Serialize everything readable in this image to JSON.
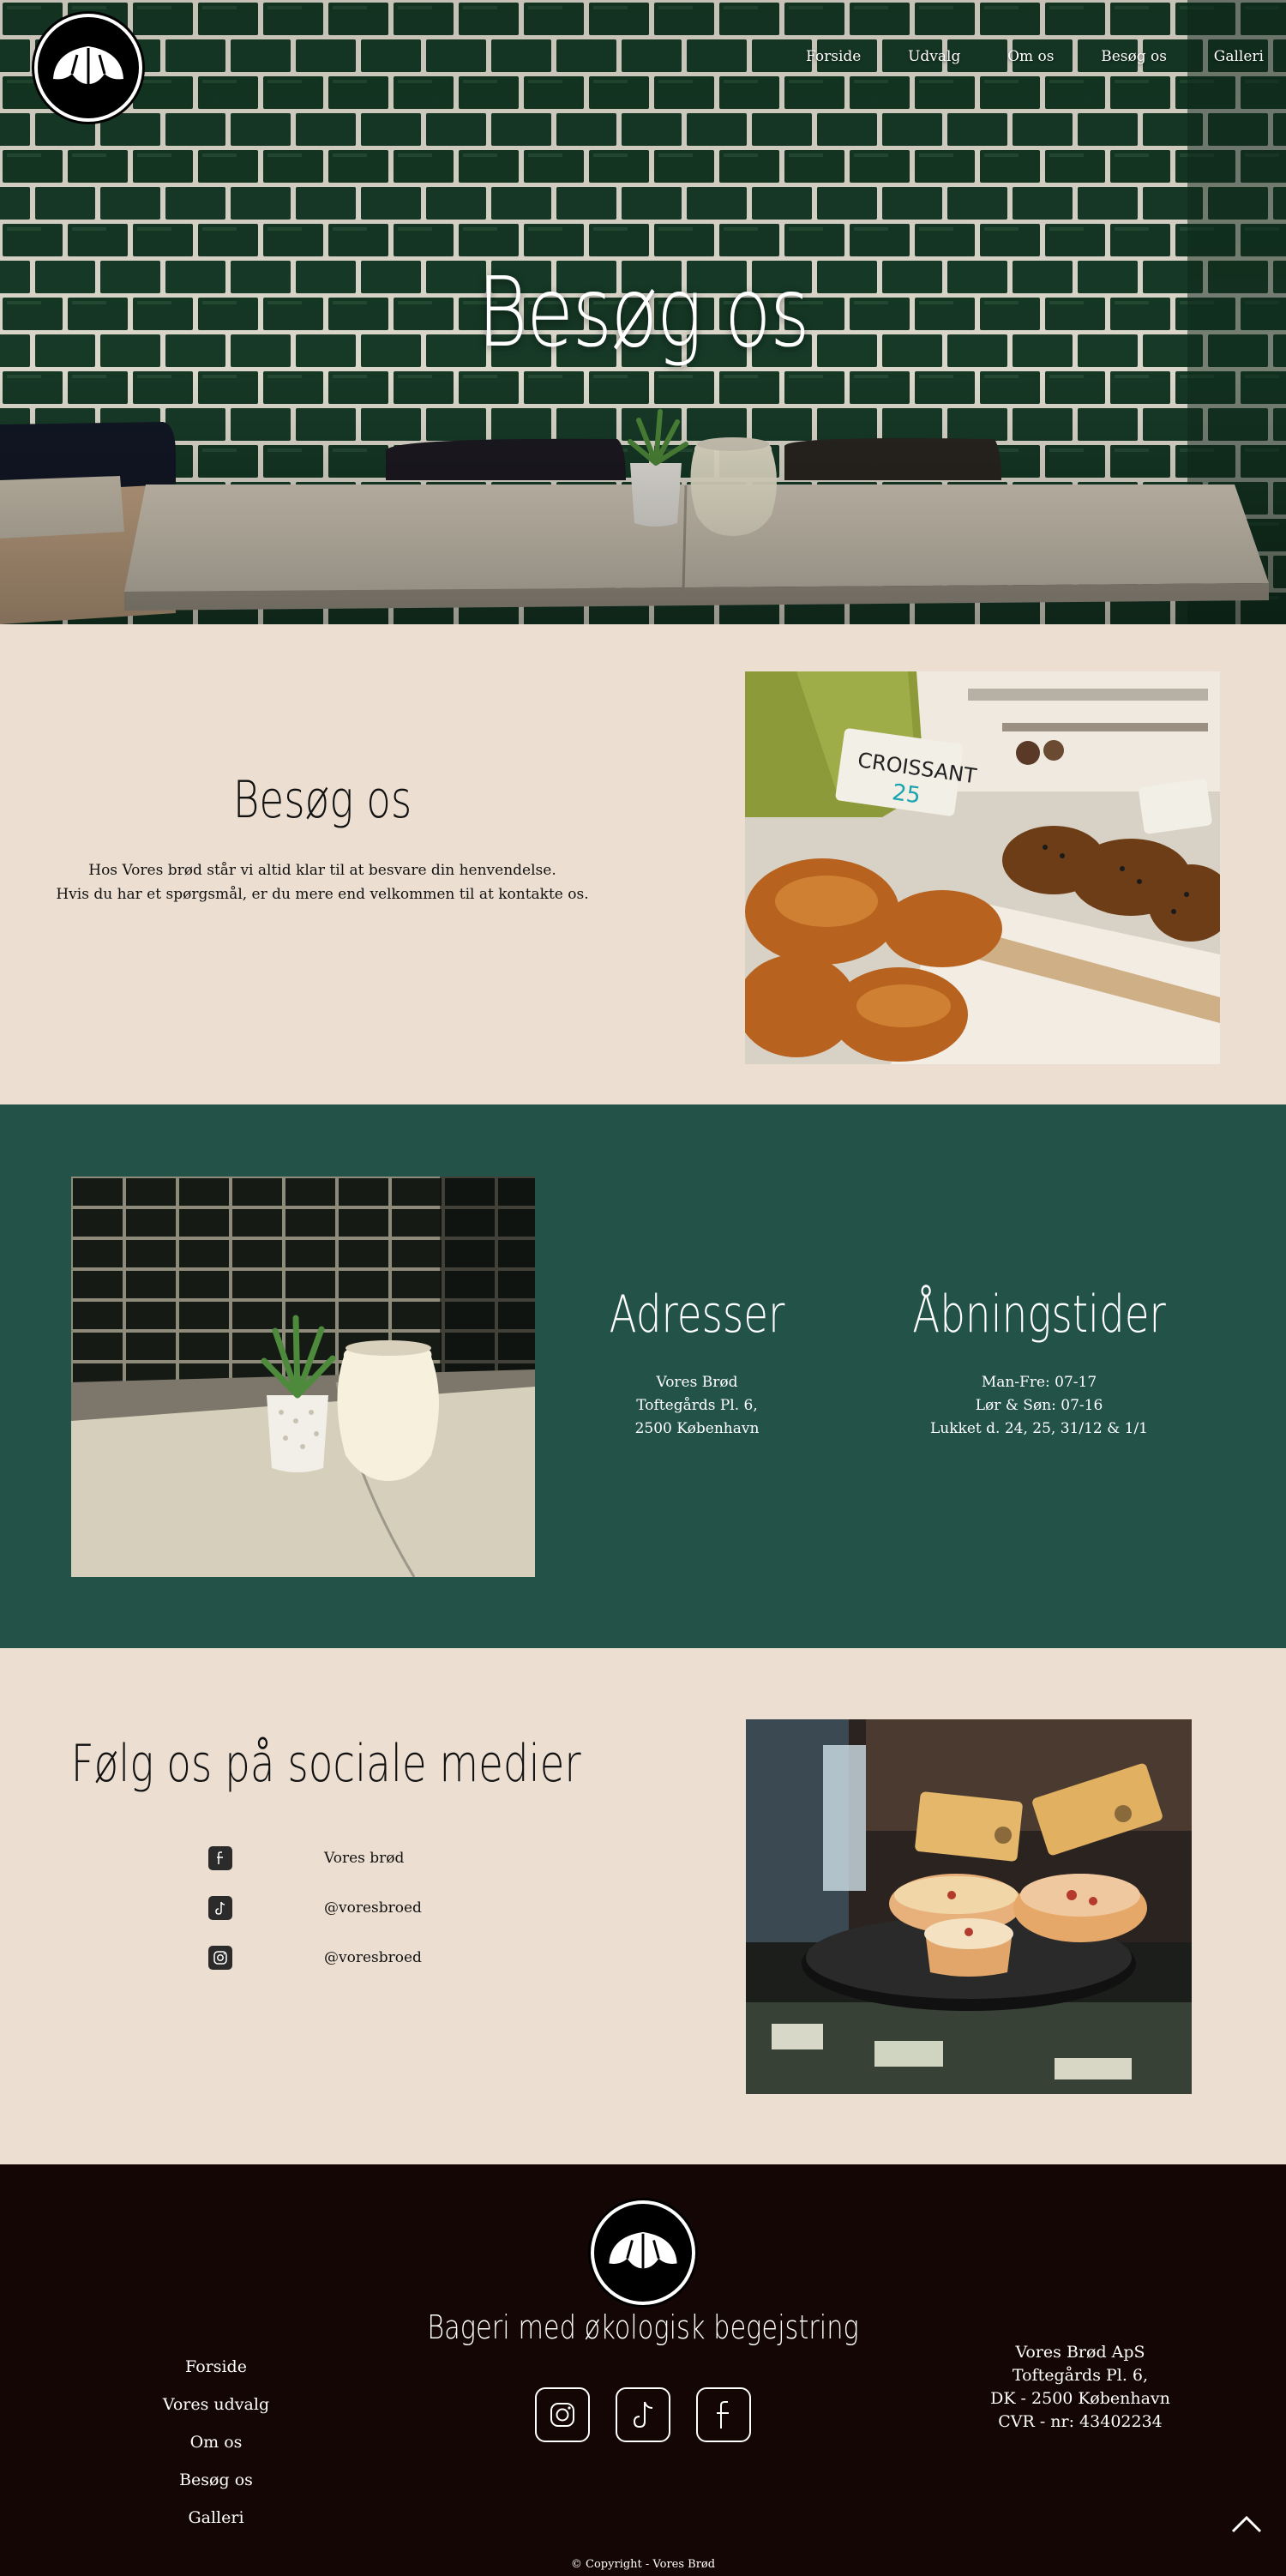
{
  "nav": {
    "items": [
      {
        "label": "Forside"
      },
      {
        "label": "Udvalg"
      },
      {
        "label": "Om os"
      },
      {
        "label": "Besøg os"
      },
      {
        "label": "Galleri"
      }
    ]
  },
  "hero": {
    "title": "Besøg os"
  },
  "visit": {
    "heading": "Besøg os",
    "line1": "Hos Vores brød står vi altid klar til at besvare din henvendelse.",
    "line2": "Hvis du har et spørgsmål, er du mere end velkommen til at kontakte os."
  },
  "addresses": {
    "heading": "Adresser",
    "lines": [
      "Vores Brød",
      "Toftegårds Pl. 6,",
      "2500 København"
    ]
  },
  "hours": {
    "heading": "Åbningstider",
    "lines": [
      "Man-Fre: 07-17",
      "Lør & Søn: 07-16",
      "Lukket d. 24, 25, 31/12 & 1/1"
    ]
  },
  "social": {
    "heading": "Følg os på sociale medier",
    "items": [
      {
        "icon": "facebook-icon",
        "label": "Vores brød"
      },
      {
        "icon": "tiktok-icon",
        "label": "@voresbroed"
      },
      {
        "icon": "instagram-icon",
        "label": "@voresbroed"
      }
    ]
  },
  "footer": {
    "tagline": "Bageri med økologisk begejstring",
    "links": [
      "Forside",
      "Vores udvalg",
      "Om os",
      "Besøg os",
      "Galleri"
    ],
    "company": [
      "Vores Brød ApS",
      "Toftegårds Pl. 6,",
      "DK - 2500 København",
      "CVR - nr: 43402234"
    ],
    "socials": [
      "instagram-icon",
      "tiktok-icon",
      "facebook-icon"
    ],
    "copyright": "© Copyright - Vores Brød"
  },
  "colors": {
    "cream": "#ecdfd1",
    "teal": "#235248",
    "footer": "#140604",
    "tile_green": "#163a26"
  }
}
